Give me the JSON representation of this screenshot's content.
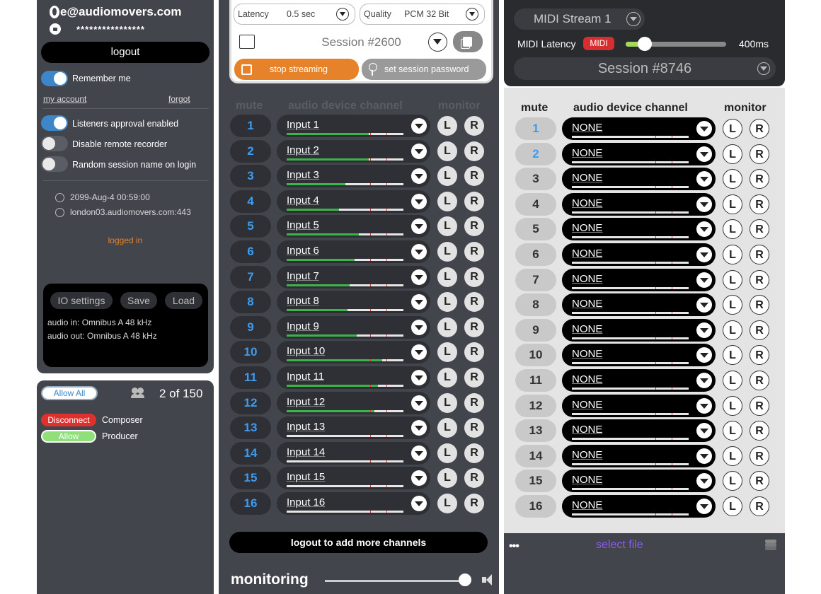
{
  "login": {
    "email": "e@audiomovers.com",
    "password_mask": "****************",
    "logout_label": "logout",
    "remember_me": "Remember me",
    "my_account": "my account",
    "forgot": "forgot",
    "toggles": [
      {
        "label": "Listeners approval enabled",
        "on": true
      },
      {
        "label": "Disable remote recorder",
        "on": false
      },
      {
        "label": "Random session name on login",
        "on": false
      }
    ],
    "expiry": "2099-Aug-4 00:59:00",
    "server": "london03.audiomovers.com:443",
    "status": "logged in"
  },
  "io": {
    "settings_label": "IO settings",
    "save_label": "Save",
    "load_label": "Load",
    "audio_in": "audio in: Omnibus A 48 kHz",
    "audio_out": "audio out: Omnibus A 48 kHz"
  },
  "listeners": {
    "allow_all": "Allow All",
    "count": "2 of 150",
    "items": [
      {
        "action": "Disconnect",
        "name": "Composer",
        "color": "#e0302d"
      },
      {
        "action": "Allow",
        "name": "Producer",
        "color": "#8fe07a"
      }
    ]
  },
  "stream": {
    "latency_label": "Latency",
    "latency_value": "0.5 sec",
    "quality_label": "Quality",
    "quality_value": "PCM 32 Bit",
    "session": "Session #2600",
    "stop_label": "stop streaming",
    "password_label": "set session password"
  },
  "headers": {
    "mute": "mute",
    "device": "audio device channel",
    "monitor": "monitor"
  },
  "mid_channels": [
    {
      "num": "1",
      "label": "Input 1",
      "level": 0.7
    },
    {
      "num": "2",
      "label": "Input 2",
      "level": 0.7
    },
    {
      "num": "3",
      "label": "Input 3",
      "level": 0.5
    },
    {
      "num": "4",
      "label": "Input 4",
      "level": 0.45
    },
    {
      "num": "5",
      "label": "Input 5",
      "level": 0.62
    },
    {
      "num": "6",
      "label": "Input 6",
      "level": 0.58
    },
    {
      "num": "7",
      "label": "Input 7",
      "level": 0.54
    },
    {
      "num": "8",
      "label": "Input 8",
      "level": 0.52
    },
    {
      "num": "9",
      "label": "Input 9",
      "level": 0.6
    },
    {
      "num": "10",
      "label": "Input 10",
      "level": 0.82
    },
    {
      "num": "11",
      "label": "Input 11",
      "level": 0.78
    },
    {
      "num": "12",
      "label": "Input 12",
      "level": 0.75
    },
    {
      "num": "13",
      "label": "Input 13",
      "level": 0
    },
    {
      "num": "14",
      "label": "Input 14",
      "level": 0
    },
    {
      "num": "15",
      "label": "Input 15",
      "level": 0
    },
    {
      "num": "16",
      "label": "Input 16",
      "level": 0
    }
  ],
  "footer": {
    "logout_more": "logout to add more channels",
    "monitoring": "monitoring"
  },
  "receiver": {
    "midi_stream": "MIDI Stream 1",
    "midi_latency_label": "MIDI Latency",
    "midi_badge": "MIDI",
    "midi_latency_value": "400ms",
    "session": "Session #8746",
    "select_file": "select file",
    "dots": "•••"
  },
  "right_channels": [
    {
      "num": "1",
      "label": "NONE",
      "active": true
    },
    {
      "num": "2",
      "label": "NONE",
      "active": true
    },
    {
      "num": "3",
      "label": "NONE",
      "active": false
    },
    {
      "num": "4",
      "label": "NONE",
      "active": false
    },
    {
      "num": "5",
      "label": "NONE",
      "active": false
    },
    {
      "num": "6",
      "label": "NONE",
      "active": false
    },
    {
      "num": "7",
      "label": "NONE",
      "active": false
    },
    {
      "num": "8",
      "label": "NONE",
      "active": false
    },
    {
      "num": "9",
      "label": "NONE",
      "active": false
    },
    {
      "num": "10",
      "label": "NONE",
      "active": false
    },
    {
      "num": "11",
      "label": "NONE",
      "active": false
    },
    {
      "num": "12",
      "label": "NONE",
      "active": false
    },
    {
      "num": "13",
      "label": "NONE",
      "active": false
    },
    {
      "num": "14",
      "label": "NONE",
      "active": false
    },
    {
      "num": "15",
      "label": "NONE",
      "active": false
    },
    {
      "num": "16",
      "label": "NONE",
      "active": false
    }
  ],
  "monitor_labels": {
    "left": "L",
    "right": "R"
  }
}
